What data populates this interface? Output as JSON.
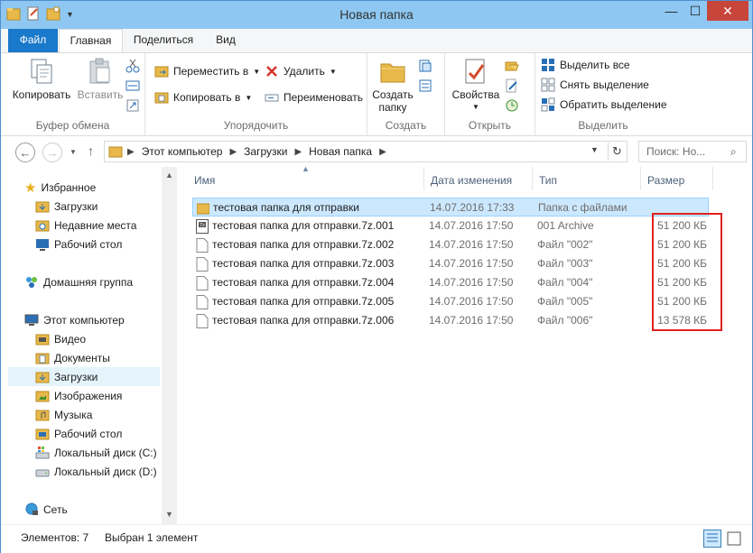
{
  "window": {
    "title": "Новая папка"
  },
  "tabs": {
    "file": "Файл",
    "home": "Главная",
    "share": "Поделиться",
    "view": "Вид"
  },
  "ribbon": {
    "clipboard": {
      "label": "Буфер обмена",
      "copy": "Копировать",
      "paste": "Вставить"
    },
    "organize": {
      "label": "Упорядочить",
      "move_to": "Переместить в",
      "copy_to": "Копировать в",
      "delete": "Удалить",
      "rename": "Переименовать"
    },
    "create": {
      "label": "Создать",
      "new_folder_line1": "Создать",
      "new_folder_line2": "папку"
    },
    "open": {
      "label": "Открыть",
      "properties": "Свойства"
    },
    "select": {
      "label": "Выделить",
      "select_all": "Выделить все",
      "select_none": "Снять выделение",
      "invert": "Обратить выделение"
    }
  },
  "address": {
    "crumbs": [
      "Этот компьютер",
      "Загрузки",
      "Новая папка"
    ],
    "search_placeholder": "Поиск: Но..."
  },
  "nav": {
    "favorites": "Избранное",
    "fav_items": [
      "Загрузки",
      "Недавние места",
      "Рабочий стол"
    ],
    "homegroup": "Домашняя группа",
    "this_pc": "Этот компьютер",
    "pc_items": [
      "Видео",
      "Документы",
      "Загрузки",
      "Изображения",
      "Музыка",
      "Рабочий стол",
      "Локальный диск (C:)",
      "Локальный диск (D:)"
    ],
    "network": "Сеть"
  },
  "columns": {
    "name": "Имя",
    "date": "Дата изменения",
    "type": "Тип",
    "size": "Размер"
  },
  "files": [
    {
      "name": "тестовая папка для отправки",
      "date": "14.07.2016 17:33",
      "type": "Папка с файлами",
      "size": ""
    },
    {
      "name": "тестовая папка для отправки.7z.001",
      "date": "14.07.2016 17:50",
      "type": "001 Archive",
      "size": "51 200 КБ"
    },
    {
      "name": "тестовая папка для отправки.7z.002",
      "date": "14.07.2016 17:50",
      "type": "Файл \"002\"",
      "size": "51 200 КБ"
    },
    {
      "name": "тестовая папка для отправки.7z.003",
      "date": "14.07.2016 17:50",
      "type": "Файл \"003\"",
      "size": "51 200 КБ"
    },
    {
      "name": "тестовая папка для отправки.7z.004",
      "date": "14.07.2016 17:50",
      "type": "Файл \"004\"",
      "size": "51 200 КБ"
    },
    {
      "name": "тестовая папка для отправки.7z.005",
      "date": "14.07.2016 17:50",
      "type": "Файл \"005\"",
      "size": "51 200 КБ"
    },
    {
      "name": "тестовая папка для отправки.7z.006",
      "date": "14.07.2016 17:50",
      "type": "Файл \"006\"",
      "size": "13 578 КБ"
    }
  ],
  "status": {
    "items_count": "Элементов: 7",
    "selected": "Выбран 1 элемент"
  },
  "colors": {
    "accent": "#1979ca",
    "highlight": "#e0201d",
    "selection": "#cce8ff",
    "folder": "#e8b94a"
  }
}
